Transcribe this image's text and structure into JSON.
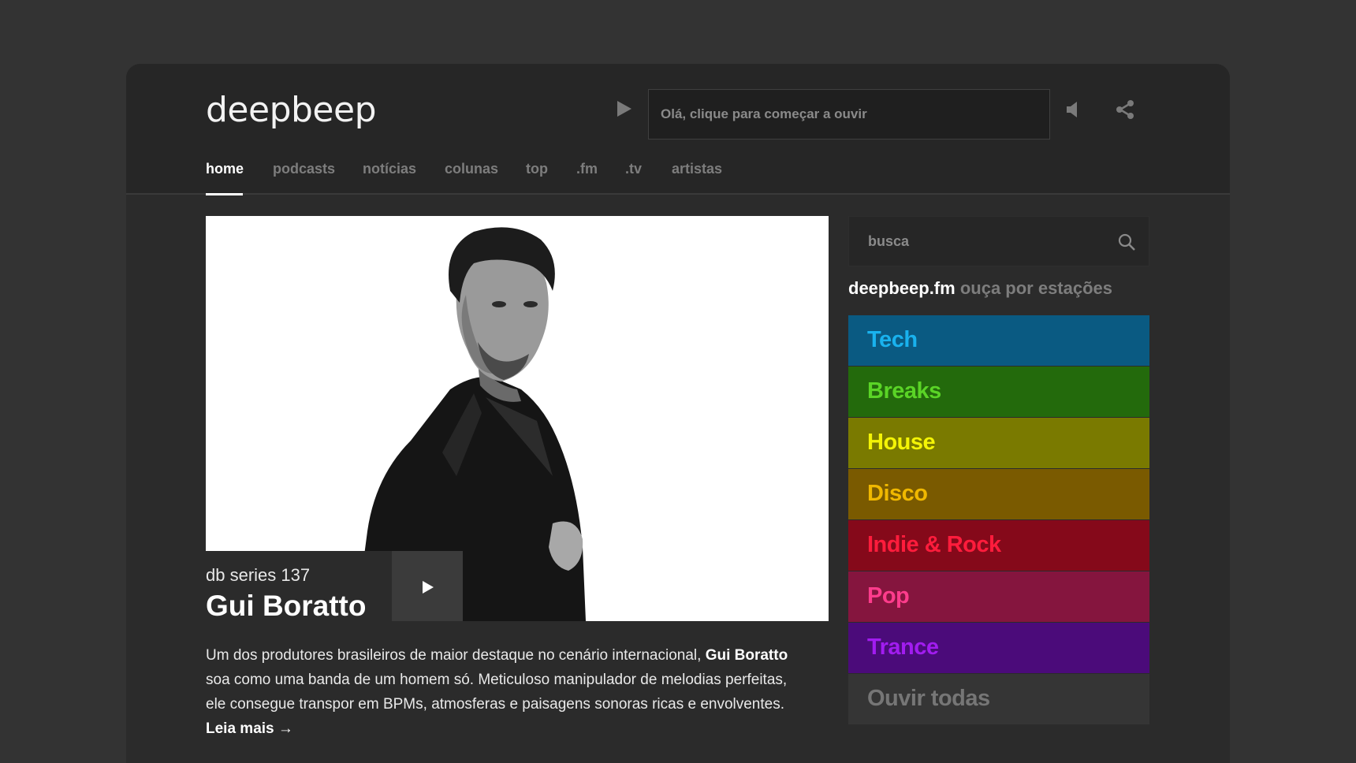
{
  "header": {
    "logo": "deepbeep",
    "player_text": "Olá, clique para começar a ouvir"
  },
  "nav": {
    "items": [
      {
        "label": "home",
        "active": true
      },
      {
        "label": "podcasts",
        "active": false
      },
      {
        "label": "notícias",
        "active": false
      },
      {
        "label": "colunas",
        "active": false
      },
      {
        "label": "top",
        "active": false
      },
      {
        "label": ".fm",
        "active": false
      },
      {
        "label": ".tv",
        "active": false
      },
      {
        "label": "artistas",
        "active": false
      }
    ]
  },
  "feature": {
    "series": "db series 137",
    "artist": "Gui Boratto",
    "description": {
      "part1": "Um dos produtores brasileiros de maior destaque no cenário internacional, ",
      "bold_name": "Gui Boratto",
      "part2": " soa como uma banda de um homem só. Meticuloso manipulador de melodias perfeitas, ele consegue transpor em BPMs, atmosferas e paisagens sonoras ricas e envolventes. ",
      "read_more": "Leia mais →"
    }
  },
  "sidebar": {
    "search_placeholder": "busca",
    "stations_brand": "deepbeep.fm",
    "stations_sub": "ouça por estações",
    "stations": [
      {
        "label": "Tech",
        "bg": "#0a5a82",
        "color": "#19b2ee"
      },
      {
        "label": "Breaks",
        "bg": "#236a0c",
        "color": "#5ad426"
      },
      {
        "label": "House",
        "bg": "#7a7a00",
        "color": "#f4f406"
      },
      {
        "label": "Disco",
        "bg": "#7a5a00",
        "color": "#f0b800"
      },
      {
        "label": "Indie & Rock",
        "bg": "#85091a",
        "color": "#ff1c3c"
      },
      {
        "label": "Pop",
        "bg": "#85153e",
        "color": "#ff3c8c"
      },
      {
        "label": "Trance",
        "bg": "#4b0b7a",
        "color": "#a21cf0"
      },
      {
        "label": "Ouvir todas",
        "bg": "#353535",
        "color": "#767676"
      }
    ]
  },
  "icons": {
    "play": "play-icon",
    "volume": "volume-icon",
    "share": "share-icon",
    "search": "search-icon"
  }
}
